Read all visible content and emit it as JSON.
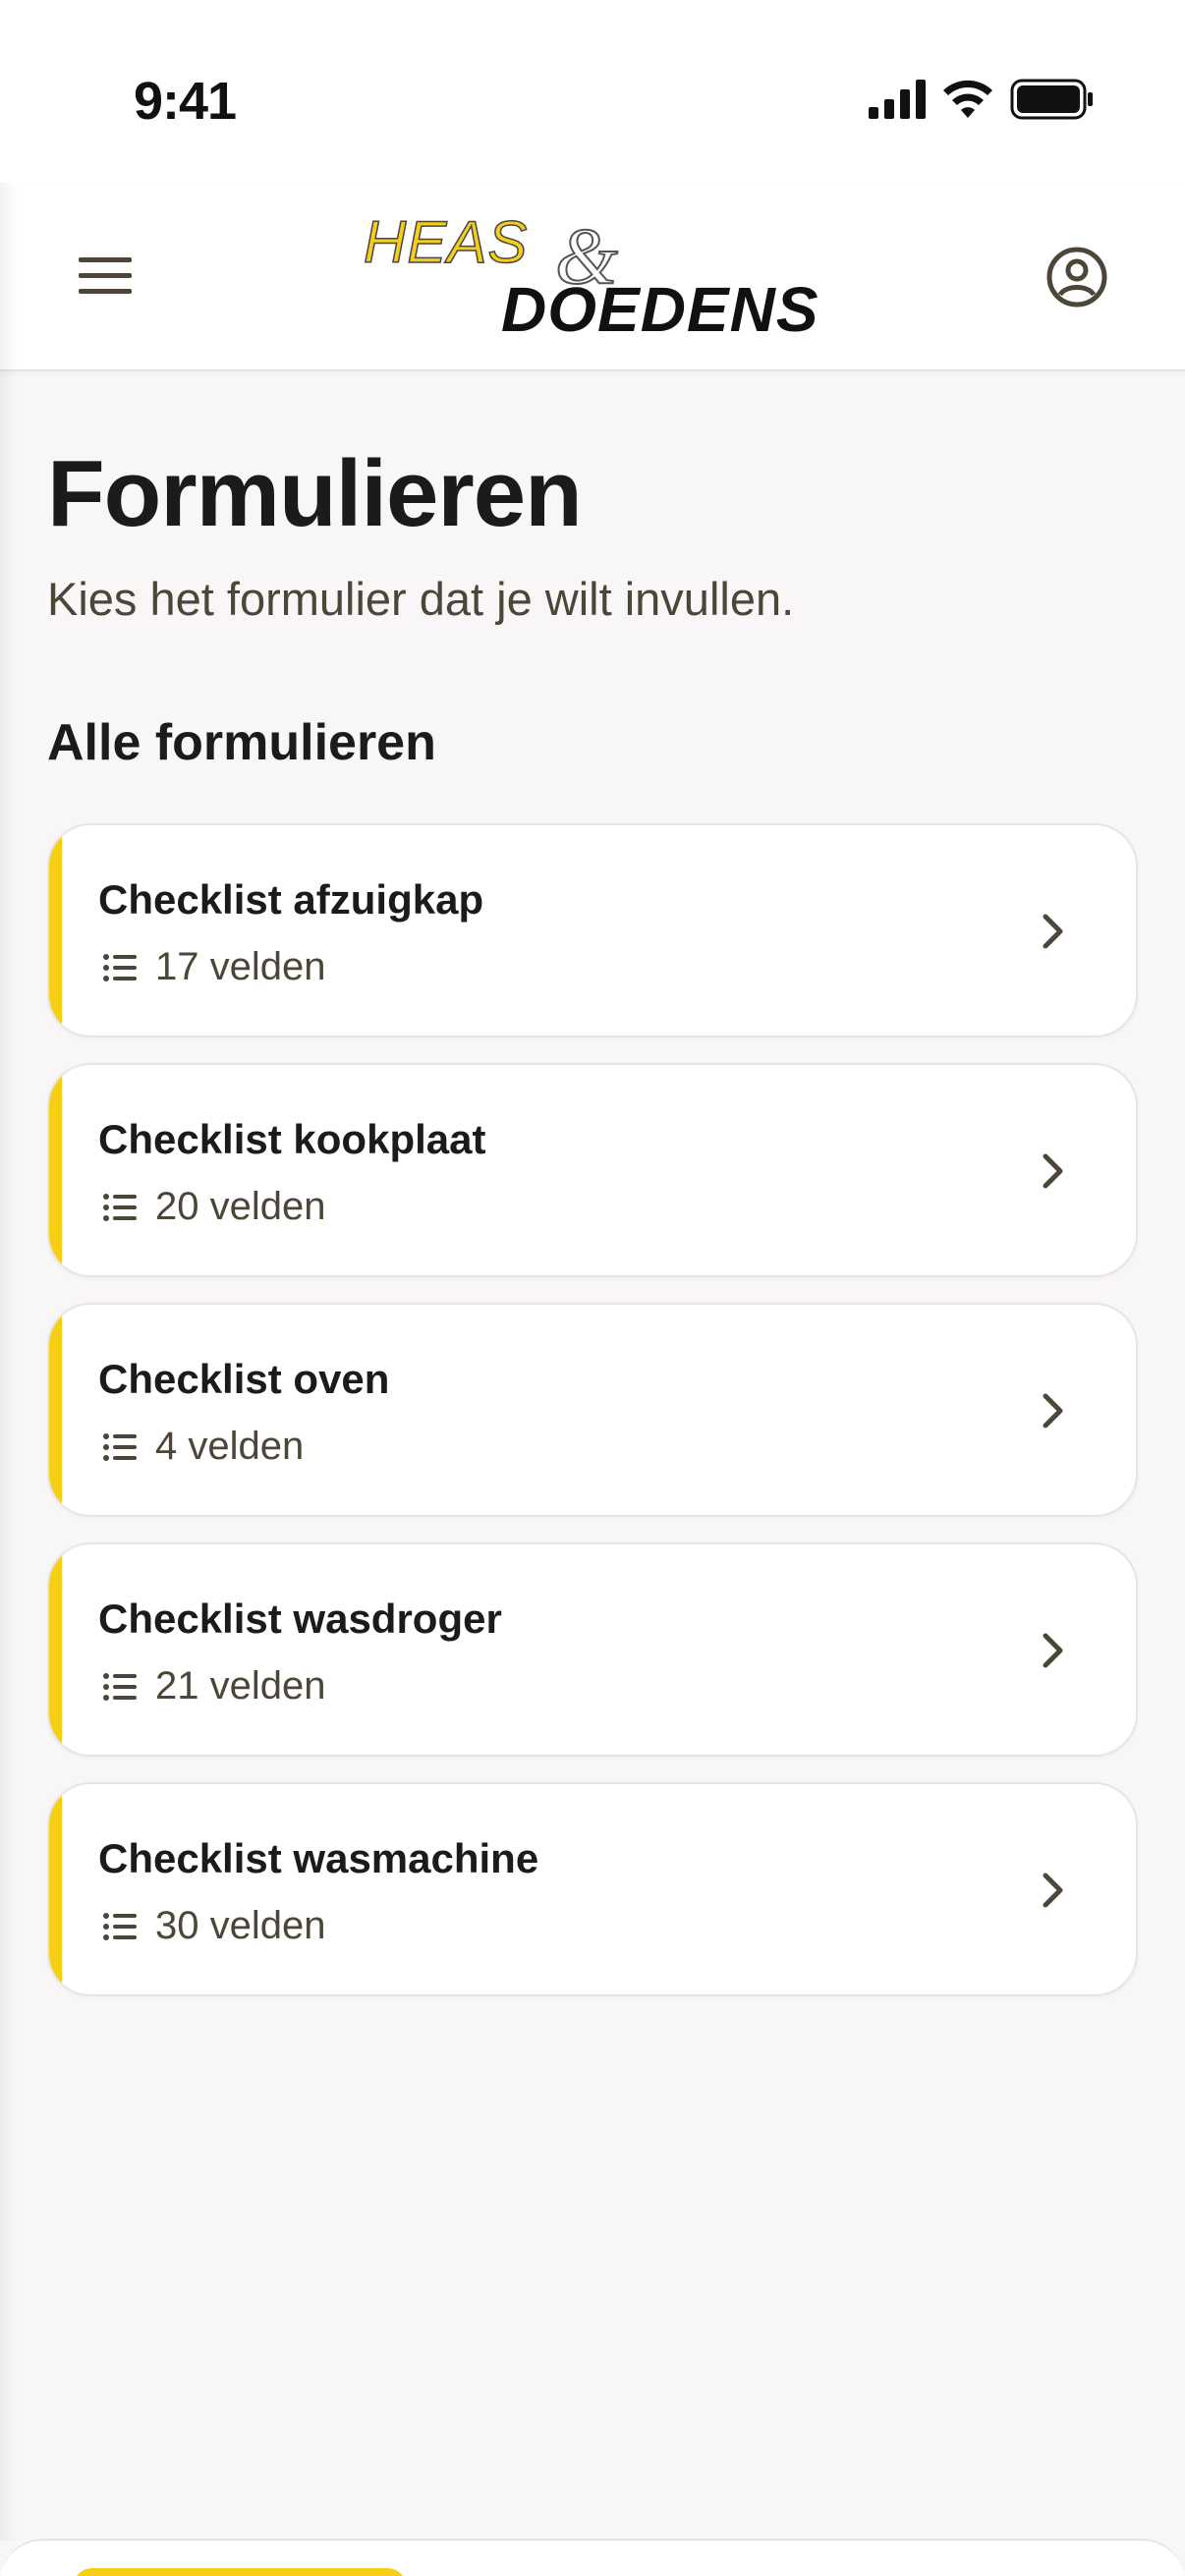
{
  "status_bar": {
    "time": "9:41"
  },
  "header": {
    "logo": {
      "top_text": "HEAS",
      "amp_text": "&",
      "bottom_text": "DOEDENS"
    },
    "menu_icon": "hamburger-menu-icon",
    "profile_icon": "user-circle-icon"
  },
  "page": {
    "title": "Formulieren",
    "subtitle": "Kies het formulier dat je wilt invullen.",
    "section_title": "Alle formulieren"
  },
  "forms": [
    {
      "title": "Checklist afzuigkap",
      "count": "17 velden"
    },
    {
      "title": "Checklist kookplaat",
      "count": "20 velden"
    },
    {
      "title": "Checklist oven",
      "count": "4 velden"
    },
    {
      "title": "Checklist wasdroger",
      "count": "21 velden"
    },
    {
      "title": "Checklist wasmachine",
      "count": "30 velden"
    }
  ],
  "colors": {
    "accent": "#f6cf14",
    "text_primary": "#1b1b1b",
    "text_secondary": "#4b4638",
    "background": "#f8f6f6",
    "card_background": "#ffffff"
  }
}
